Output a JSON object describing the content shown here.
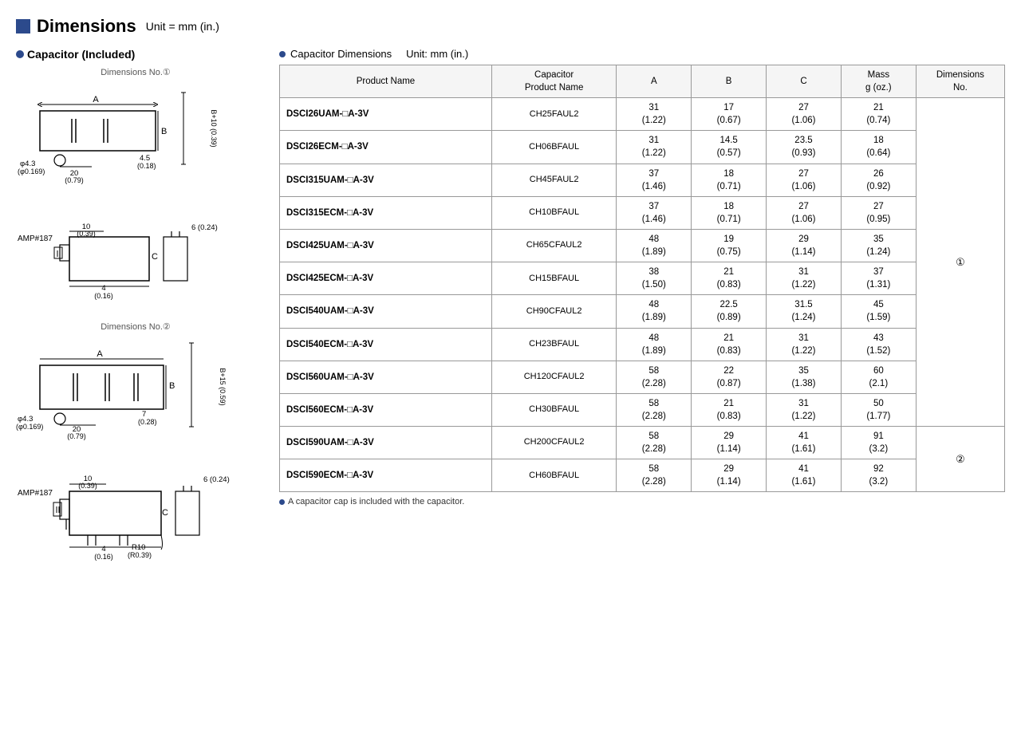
{
  "page": {
    "title": "Dimensions",
    "title_unit": "Unit = mm (in.)",
    "left_section_title": "Capacitor (Included)",
    "table_section_title": "Capacitor Dimensions",
    "table_section_unit": "Unit: mm (in.)",
    "footnote": "A capacitor cap is included with the capacitor.",
    "dim1_label": "Dimensions No.①",
    "dim2_label": "Dimensions No.②"
  },
  "table": {
    "headers": {
      "product_name": "Product Name",
      "cap_product_name": "Capacitor\nProduct Name",
      "a": "A",
      "b": "B",
      "c": "C",
      "mass": "Mass\ng (oz.)",
      "dim_no": "Dimensions\nNo."
    },
    "rows": [
      {
        "product": "DSCI26UAM-□A-3V",
        "cap": "CH25FAUL2",
        "a": "31\n(1.22)",
        "b": "17\n(0.67)",
        "c": "27\n(1.06)",
        "mass": "21\n(0.74)",
        "dim": "①"
      },
      {
        "product": "DSCI26ECM-□A-3V",
        "cap": "CH06BFAUL",
        "a": "31\n(1.22)",
        "b": "14.5\n(0.57)",
        "c": "23.5\n(0.93)",
        "mass": "18\n(0.64)",
        "dim": ""
      },
      {
        "product": "DSCI315UAM-□A-3V",
        "cap": "CH45FAUL2",
        "a": "37\n(1.46)",
        "b": "18\n(0.71)",
        "c": "27\n(1.06)",
        "mass": "26\n(0.92)",
        "dim": ""
      },
      {
        "product": "DSCI315ECM-□A-3V",
        "cap": "CH10BFAUL",
        "a": "37\n(1.46)",
        "b": "18\n(0.71)",
        "c": "27\n(1.06)",
        "mass": "27\n(0.95)",
        "dim": ""
      },
      {
        "product": "DSCI425UAM-□A-3V",
        "cap": "CH65CFAUL2",
        "a": "48\n(1.89)",
        "b": "19\n(0.75)",
        "c": "29\n(1.14)",
        "mass": "35\n(1.24)",
        "dim": "①"
      },
      {
        "product": "DSCI425ECM-□A-3V",
        "cap": "CH15BFAUL",
        "a": "38\n(1.50)",
        "b": "21\n(0.83)",
        "c": "31\n(1.22)",
        "mass": "37\n(1.31)",
        "dim": ""
      },
      {
        "product": "DSCI540UAM-□A-3V",
        "cap": "CH90CFAUL2",
        "a": "48\n(1.89)",
        "b": "22.5\n(0.89)",
        "c": "31.5\n(1.24)",
        "mass": "45\n(1.59)",
        "dim": ""
      },
      {
        "product": "DSCI540ECM-□A-3V",
        "cap": "CH23BFAUL",
        "a": "48\n(1.89)",
        "b": "21\n(0.83)",
        "c": "31\n(1.22)",
        "mass": "43\n(1.52)",
        "dim": ""
      },
      {
        "product": "DSCI560UAM-□A-3V",
        "cap": "CH120CFAUL2",
        "a": "58\n(2.28)",
        "b": "22\n(0.87)",
        "c": "35\n(1.38)",
        "mass": "60\n(2.1)",
        "dim": ""
      },
      {
        "product": "DSCI560ECM-□A-3V",
        "cap": "CH30BFAUL",
        "a": "58\n(2.28)",
        "b": "21\n(0.83)",
        "c": "31\n(1.22)",
        "mass": "50\n(1.77)",
        "dim": ""
      },
      {
        "product": "DSCI590UAM-□A-3V",
        "cap": "CH200CFAUL2",
        "a": "58\n(2.28)",
        "b": "29\n(1.14)",
        "c": "41\n(1.61)",
        "mass": "91\n(3.2)",
        "dim": "②"
      },
      {
        "product": "DSCI590ECM-□A-3V",
        "cap": "CH60BFAUL",
        "a": "58\n(2.28)",
        "b": "29\n(1.14)",
        "c": "41\n(1.61)",
        "mass": "92\n(3.2)",
        "dim": ""
      }
    ]
  }
}
